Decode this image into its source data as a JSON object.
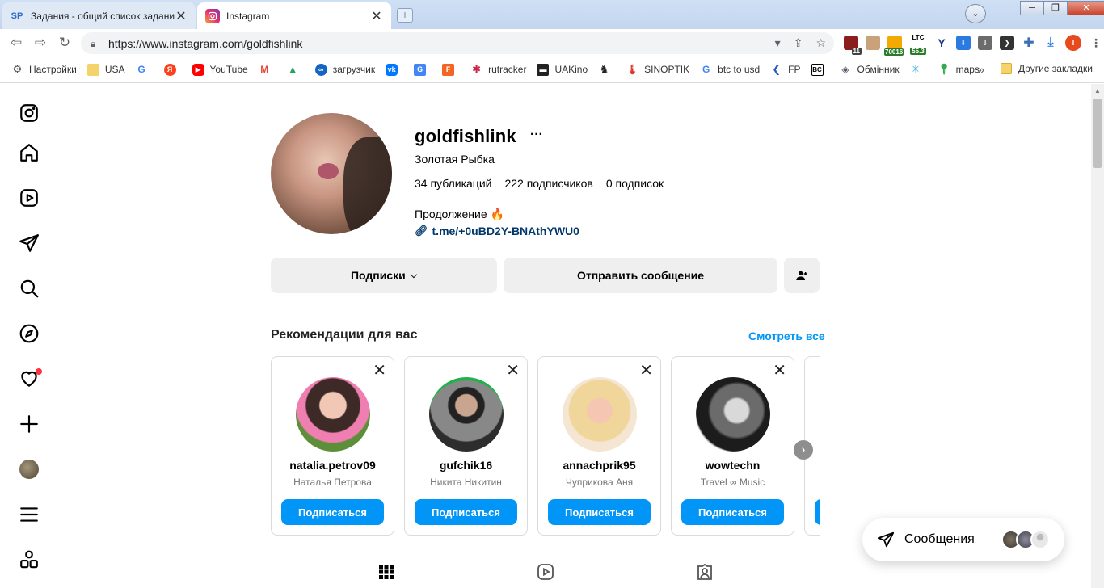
{
  "browser": {
    "tabs": [
      {
        "icon": "SP",
        "title": "Задания - общий список заданий",
        "close": "✕"
      },
      {
        "icon": "instagram-icon",
        "title": "Instagram",
        "close": "✕"
      }
    ],
    "url": "https://www.instagram.com/goldfishlink",
    "extension_badges": {
      "tabs_count": "11",
      "price": "70016",
      "ltc_label": "LTC",
      "ltc_value": "55.3",
      "profile_letter": "I"
    },
    "bookmarks": [
      "Настройки",
      "USA",
      "",
      "",
      "YouTube",
      "",
      "",
      "загрузчик",
      "",
      "",
      "",
      "rutracker",
      "UAKino",
      "",
      "SINOPTIK",
      "btc to usd",
      "FP",
      "",
      "Обмінник",
      "",
      "maps"
    ],
    "bookmarks_more": "»",
    "other_bookmarks": "Другие закладки"
  },
  "profile": {
    "username": "goldfishlink",
    "more": "···",
    "full_name": "Золотая Рыбка",
    "stats": {
      "posts": "34 публикаций",
      "followers": "222 подписчиков",
      "following": "0 подписок"
    },
    "bio": "Продолжение 🔥",
    "link": "t.me/+0uBD2Y-BNAthYWU0"
  },
  "actions": {
    "following_label": "Подписки",
    "message_label": "Отправить сообщение"
  },
  "recommendations": {
    "title": "Рекомендации для вас",
    "see_all": "Смотреть все",
    "cards": [
      {
        "username": "natalia.petrov09",
        "full_name": "Наталья Петрова",
        "button": "Подписаться"
      },
      {
        "username": "gufchik16",
        "full_name": "Никита Никитин",
        "button": "Подписаться"
      },
      {
        "username": "annachprik95",
        "full_name": "Чуприкова Аня",
        "button": "Подписаться"
      },
      {
        "username": "wowtechn",
        "full_name": "Travel ∞ Music",
        "button": "Подписаться"
      }
    ],
    "close_icon": "✕"
  },
  "messages": {
    "label": "Сообщения"
  },
  "colors": {
    "accent": "#0095f6",
    "notification": "#ff3040",
    "button_bg": "#efefef"
  }
}
